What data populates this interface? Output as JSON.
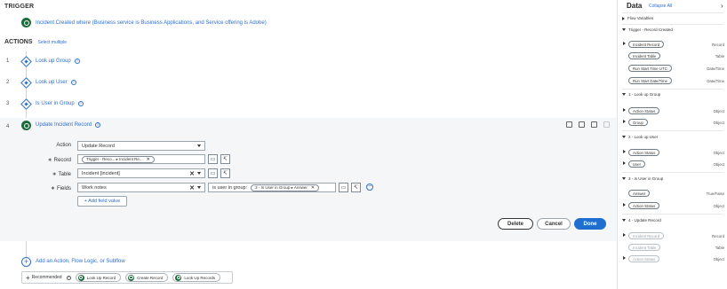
{
  "trigger": {
    "title": "TRIGGER",
    "text": "Incident Created where (Business service is Business Applications, and Service offering is Adobe)"
  },
  "actions": {
    "title": "ACTIONS",
    "select_multiple": "Select multiple",
    "steps": [
      {
        "num": "1",
        "label": "Look up Group"
      },
      {
        "num": "2",
        "label": "Look up User"
      },
      {
        "num": "3",
        "label": "Is User in Group"
      },
      {
        "num": "4",
        "label": "Update Incident Record"
      }
    ]
  },
  "form": {
    "action_label": "Action",
    "action_value": "Update Record",
    "record_label": "Record",
    "record_pill": "Trigger - Reco... ▸ Incident Re...",
    "table_label": "Table",
    "table_value": "Incident [incident]",
    "fields_label": "Fields",
    "field_name": "Work notes",
    "field_value_prefix": "is user in group:",
    "field_value_pill": "3 - Is User in Group ▸ Answer",
    "add_field": "+ Add field value",
    "required_mark": "∗"
  },
  "buttons": {
    "delete": "Delete",
    "cancel": "Cancel",
    "done": "Done"
  },
  "add_action": {
    "plus": "+",
    "text": "Add an Action, Flow Logic, or Subflow"
  },
  "recommended": {
    "label": "Recommended",
    "info": "?",
    "chips": [
      "Look Up Record",
      "Create Record",
      "Look Up Records"
    ]
  },
  "data_panel": {
    "title": "Data",
    "collapse": "Collapse All",
    "chevron": "›",
    "flow_variables": "Flow Variables",
    "sections": [
      {
        "title": "Trigger - Record Created",
        "items": [
          {
            "label": "Incident Record",
            "type": "Record",
            "expandable": true
          },
          {
            "label": "Incident Table",
            "type": "Table",
            "expandable": false
          },
          {
            "label": "Run Start Time UTC",
            "type": "Date/Time",
            "expandable": false
          },
          {
            "label": "Run Start Date/Time",
            "type": "Date/Time",
            "expandable": false
          }
        ]
      },
      {
        "title": "1 - Look up Group",
        "items": [
          {
            "label": "Action Status",
            "type": "Object",
            "expandable": true
          },
          {
            "label": "Group",
            "type": "Object",
            "expandable": true
          }
        ]
      },
      {
        "title": "2 - Look up User",
        "items": [
          {
            "label": "Action Status",
            "type": "Object",
            "expandable": true
          },
          {
            "label": "User",
            "type": "Object",
            "expandable": true
          }
        ]
      },
      {
        "title": "3 - Is User in Group",
        "items": [
          {
            "label": "Answer",
            "type": "True/False",
            "expandable": false
          },
          {
            "label": "Action Status",
            "type": "Object",
            "expandable": true
          }
        ]
      },
      {
        "title": "4 - Update Record",
        "items": [
          {
            "label": "Incident Record",
            "type": "Record",
            "expandable": true,
            "dim": true
          },
          {
            "label": "Incident Table",
            "type": "Table",
            "expandable": false,
            "dim": true
          },
          {
            "label": "Action Status",
            "type": "Object",
            "expandable": true,
            "dim": true
          }
        ]
      }
    ]
  },
  "colors": {
    "accent": "#2e6fd1",
    "trigger_green": "#1c6b3a",
    "done_button": "#1f6fd0"
  }
}
